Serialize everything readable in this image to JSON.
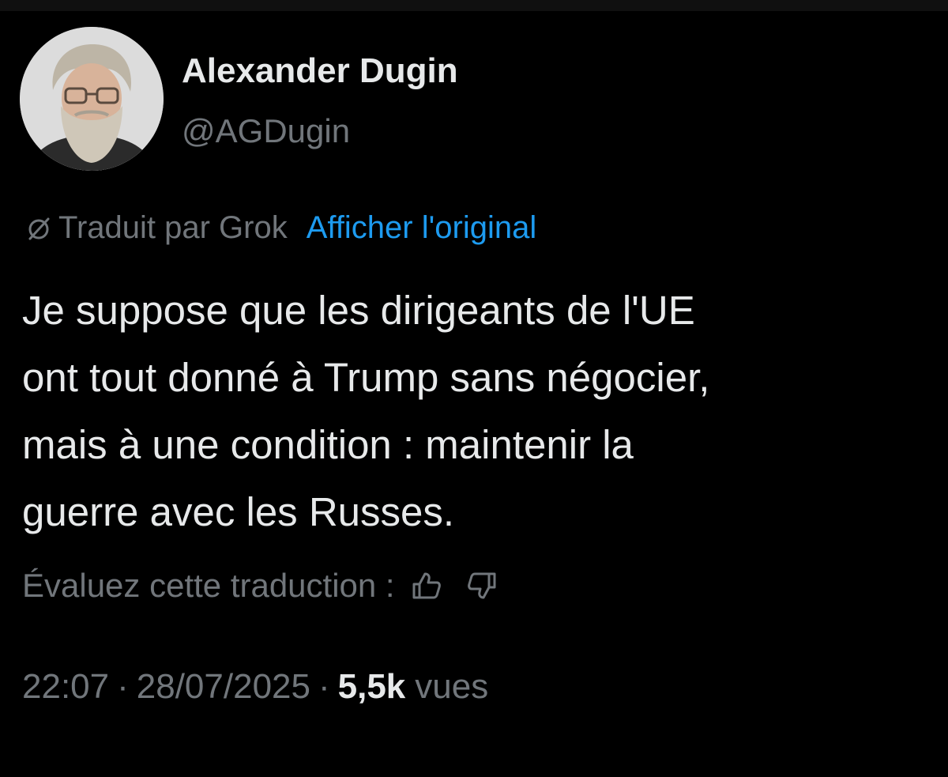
{
  "author": {
    "display_name": "Alexander Dugin",
    "handle": "@AGDugin",
    "avatar": "avatar-photo"
  },
  "translation": {
    "icon": "translate-icon",
    "translated_by": "Traduit par Grok",
    "show_original": "Afficher l'original"
  },
  "tweet": {
    "lines": [
      "Je suppose que les dirigeants de l'UE",
      "ont tout donné à Trump sans négocier,",
      "mais à une condition : maintenir la",
      "guerre avec les Russes."
    ]
  },
  "rating": {
    "label": "Évaluez cette traduction :",
    "icons": [
      "thumbs-up-icon",
      "thumbs-down-icon"
    ]
  },
  "meta": {
    "time": "22:07",
    "separator": "·",
    "date": "28/07/2025",
    "views_count": "5,5k",
    "views_label": "vues"
  },
  "colors": {
    "background": "#000000",
    "primary_text": "#e7e9ea",
    "secondary_text": "#71767b",
    "link": "#1d9bf0"
  }
}
